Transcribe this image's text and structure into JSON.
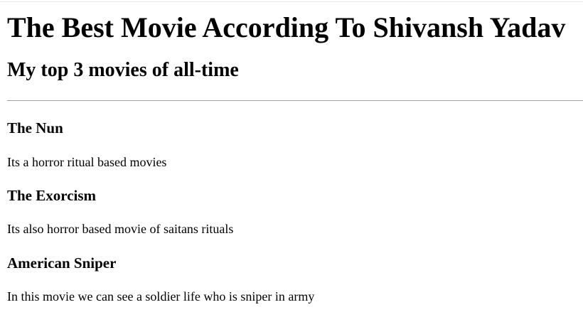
{
  "page": {
    "title": "The Best Movie According To Shivansh Yadav",
    "subtitle": "My top 3 movies of all-time"
  },
  "movies": [
    {
      "title": "The Nun",
      "description": "Its a horror ritual based movies"
    },
    {
      "title": "The Exorcism",
      "description": "Its also horror based movie of saitans rituals"
    },
    {
      "title": "American Sniper",
      "description": "In this movie we can see a soldier life who is sniper in army"
    }
  ]
}
